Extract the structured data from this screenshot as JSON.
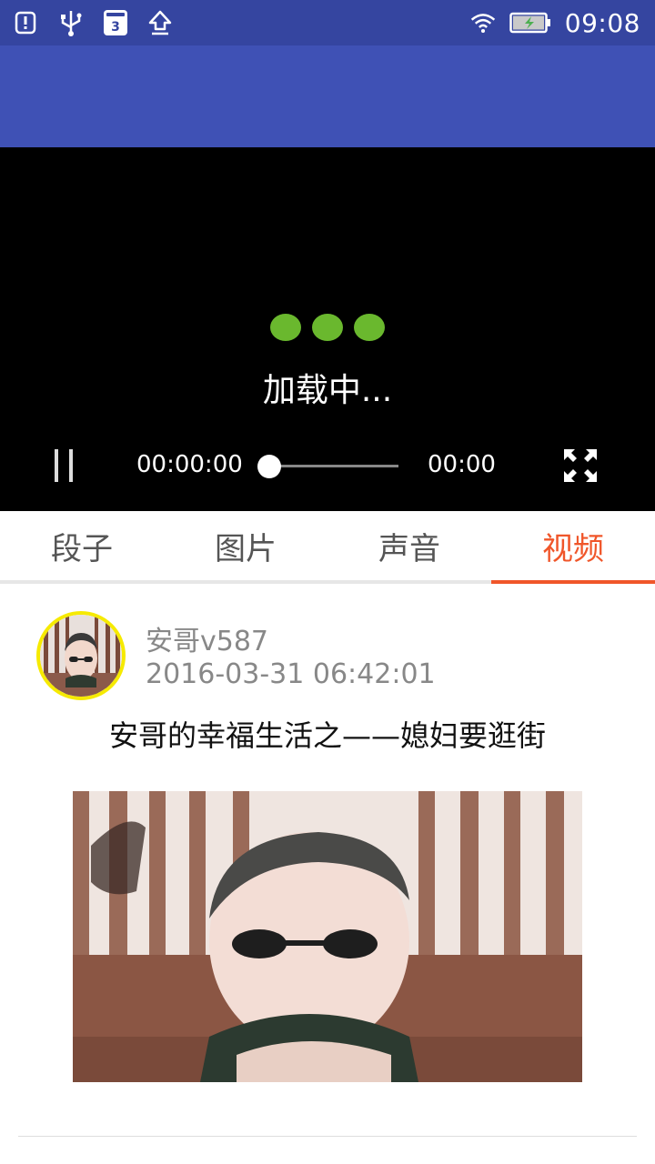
{
  "status_bar": {
    "calendar_day": "3",
    "time": "09:08",
    "icons": [
      "alert-icon",
      "usb-icon",
      "calendar-icon",
      "upload-icon",
      "wifi-icon",
      "battery-icon"
    ]
  },
  "player": {
    "loading_text": "加载中...",
    "current_time": "00:00:00",
    "total_time": "00:00",
    "progress": 0,
    "loading_dot_color": "#6ab82e"
  },
  "tabs": [
    {
      "label": "段子",
      "active": false
    },
    {
      "label": "图片",
      "active": false
    },
    {
      "label": "声音",
      "active": false
    },
    {
      "label": "视频",
      "active": true
    }
  ],
  "post": {
    "author": "安哥v587",
    "time": "2016-03-31 06:42:01",
    "title": "安哥的幸福生活之——媳妇要逛街"
  },
  "colors": {
    "status_bar": "#3545a0",
    "app_bar": "#3f51b5",
    "accent": "#f0562a",
    "avatar_ring": "#f6ea00"
  }
}
